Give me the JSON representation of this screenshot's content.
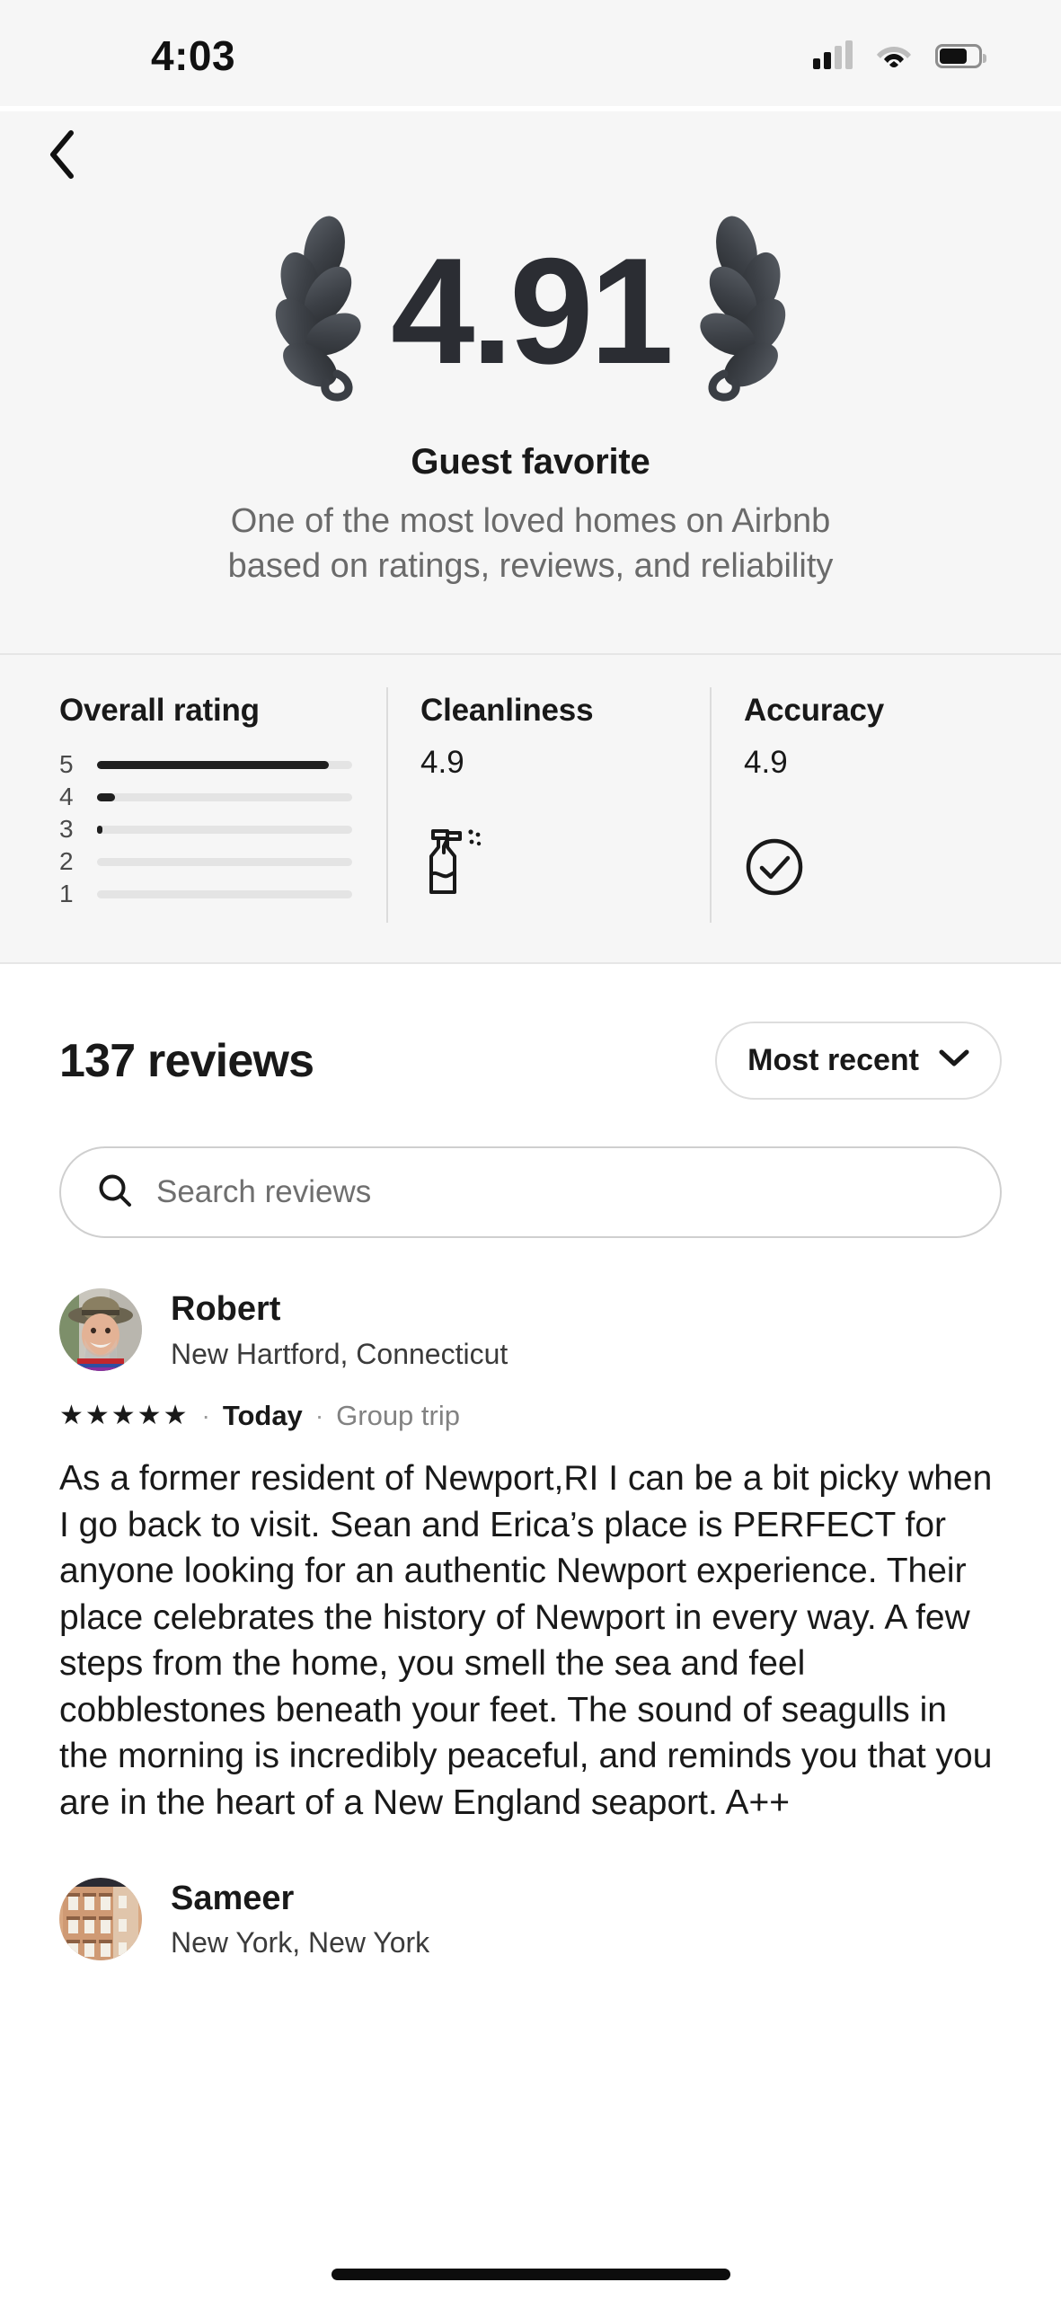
{
  "status_bar": {
    "time": "4:03",
    "cellular_icon": "cellular-signal-icon",
    "wifi_icon": "wifi-icon",
    "battery_icon": "battery-icon"
  },
  "nav": {
    "back_icon": "chevron-left-icon"
  },
  "hero": {
    "score": "4.91",
    "laurel_left_icon": "laurel-leaf-left-icon",
    "laurel_right_icon": "laurel-leaf-right-icon",
    "title": "Guest favorite",
    "subtitle_line1": "One of the most loved homes on Airbnb",
    "subtitle_line2": "based on ratings, reviews, and reliability"
  },
  "categories": {
    "overall": {
      "title": "Overall rating",
      "rows": [
        {
          "label": "5",
          "percent": 91
        },
        {
          "label": "4",
          "percent": 7
        },
        {
          "label": "3",
          "percent": 1
        },
        {
          "label": "2",
          "percent": 0
        },
        {
          "label": "1",
          "percent": 0
        }
      ]
    },
    "items": [
      {
        "title": "Cleanliness",
        "value": "4.9",
        "icon": "spray-bottle-icon"
      },
      {
        "title": "Accuracy",
        "value": "4.9",
        "icon": "check-circle-icon"
      }
    ]
  },
  "reviews_section": {
    "count_label": "137 reviews",
    "sort": {
      "label": "Most recent",
      "chevron_icon": "chevron-down-icon"
    },
    "search": {
      "placeholder": "Search reviews",
      "icon": "search-icon",
      "value": ""
    },
    "reviews": [
      {
        "name": "Robert",
        "location": "New Hartford, Connecticut",
        "avatar_icon": "avatar-photo-man-in-hat",
        "stars": "★★★★★",
        "rating": 5,
        "date": "Today",
        "trip_type": "Group trip",
        "separator": "·",
        "body": "As a former resident of Newport,RI I can be a bit picky when I go back to visit. Sean and Erica’s place is PERFECT for anyone looking for an authentic Newport experience. Their place celebrates the history of Newport in every way. A few steps from the home, you smell the sea and feel cobblestones beneath your feet. The sound of seagulls in the morning is incredibly peaceful, and reminds you that you are in the heart of a New England seaport. A++"
      },
      {
        "name": "Sameer",
        "location": "New York, New York",
        "avatar_icon": "avatar-photo-brownstone-building",
        "stars": "",
        "rating": null,
        "date": "",
        "trip_type": "",
        "separator": "",
        "body": ""
      }
    ]
  },
  "colors": {
    "hero_background": "#f6f6f6",
    "page_background": "#ffffff",
    "text_primary": "#191919",
    "text_secondary": "#6a6a6a",
    "bar_fill": "#1f1f1f",
    "bar_track": "#e4e4e4",
    "score_color": "#2b2d33"
  }
}
